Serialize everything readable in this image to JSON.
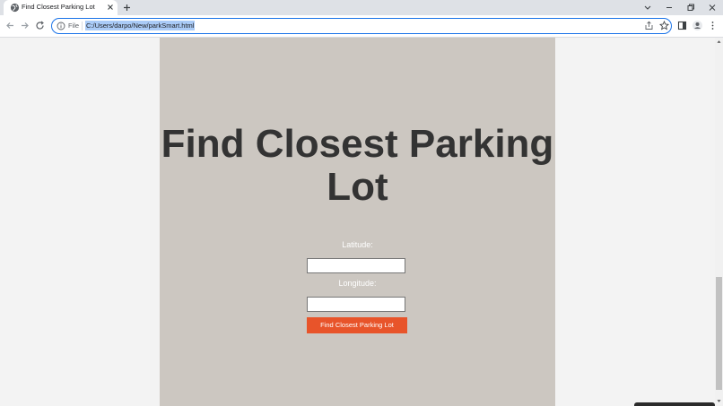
{
  "browser": {
    "tab_title": "Find Closest Parking Lot",
    "scheme_label": "File",
    "url": "C:/Users/darpo/New/parkSmart.html"
  },
  "page": {
    "heading": "Find Closest Parking Lot",
    "latitude_label": "Latitude:",
    "longitude_label": "Longitude:",
    "latitude_value": "",
    "longitude_value": "",
    "submit_label": "Find Closest Parking Lot"
  },
  "colors": {
    "card_background": "#ccc7c1",
    "button_background": "#e8542a",
    "heading_text": "#333333",
    "omnibox_focus": "#1a73e8"
  }
}
